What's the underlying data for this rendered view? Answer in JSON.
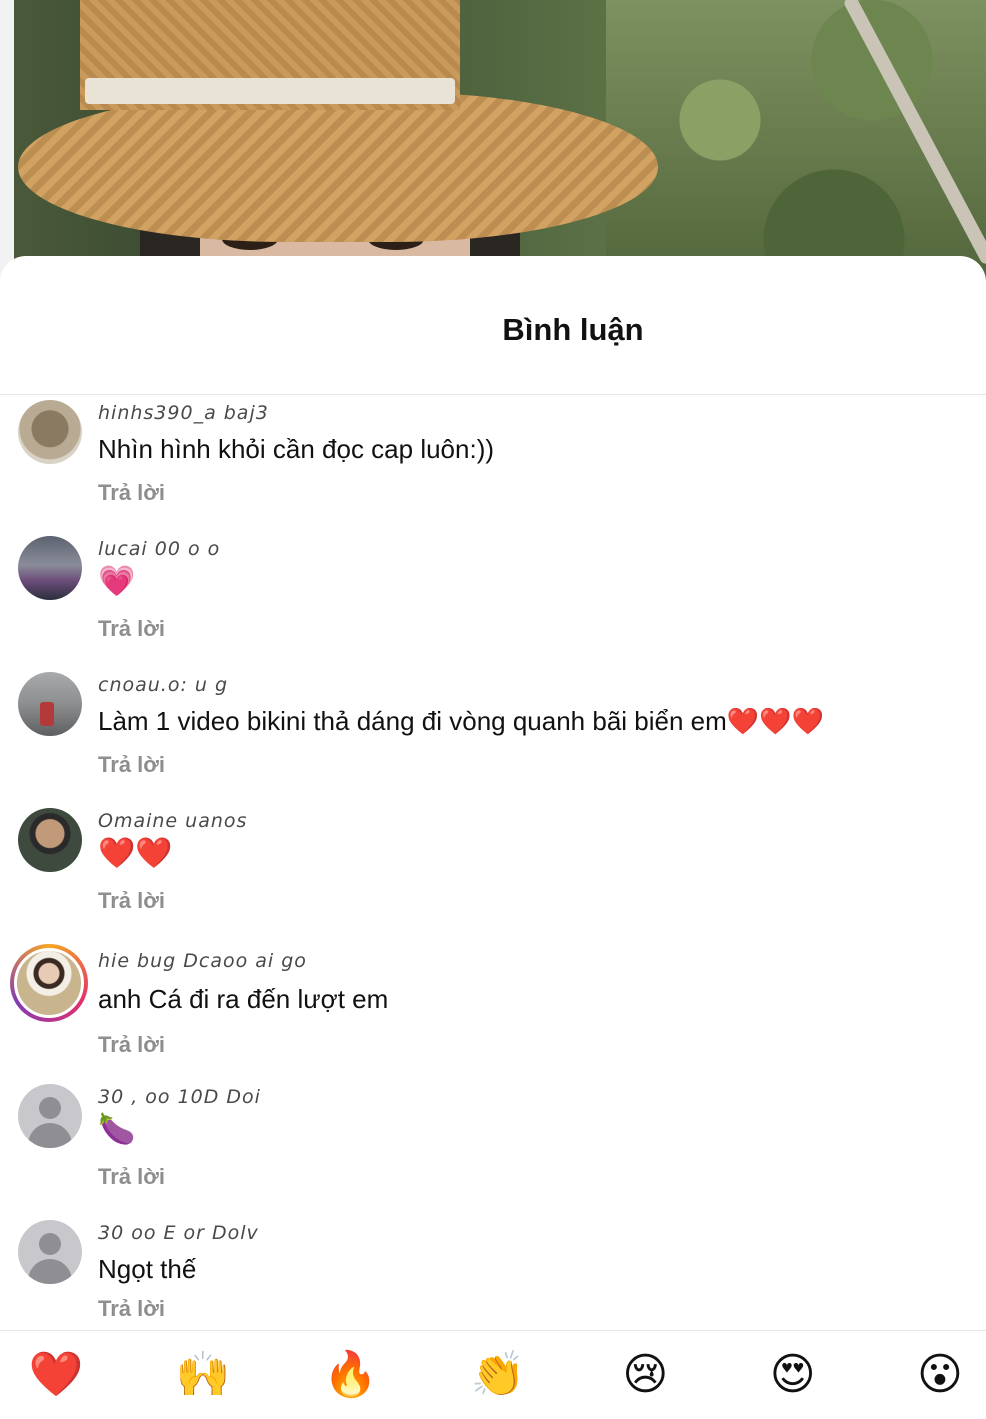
{
  "sheet": {
    "title": "Bình luận"
  },
  "comments": [
    {
      "username": "hinhs390_a   baj3",
      "text": "Nhìn hình khỏi cần đọc cap luôn:))",
      "reply": "Trả lời",
      "avatar": "cat-avatar"
    },
    {
      "username": "lucai 00   o  o",
      "text": "💗",
      "reply": "Trả lời",
      "avatar": "city-avatar"
    },
    {
      "username": "cnoau.o:  u  g",
      "text": "Làm 1 video bikini thả dáng đi vòng quanh bãi biển em❤️❤️❤️",
      "reply": "Trả lời",
      "avatar": "road-avatar"
    },
    {
      "username": "Omaine       uanos",
      "text": "❤️❤️",
      "reply": "Trả lời",
      "avatar": "man-avatar"
    },
    {
      "username": "hie bug Dcaoo ai go",
      "text": "anh Cá đi ra đến lượt em",
      "reply": "Trả lời",
      "avatar": "girl-avatar-story"
    },
    {
      "username": "30 , oo     10D     Doi",
      "text": "🍆",
      "reply": "Trả lời",
      "avatar": "default-avatar"
    },
    {
      "username": "30   oo E    or     Dolv",
      "text": "Ngọt thế",
      "reply": "Trả lời",
      "avatar": "default-avatar"
    }
  ],
  "emoji_bar": [
    "❤️",
    "🙌",
    "🔥",
    "👏",
    "😢",
    "😍",
    "😮"
  ]
}
